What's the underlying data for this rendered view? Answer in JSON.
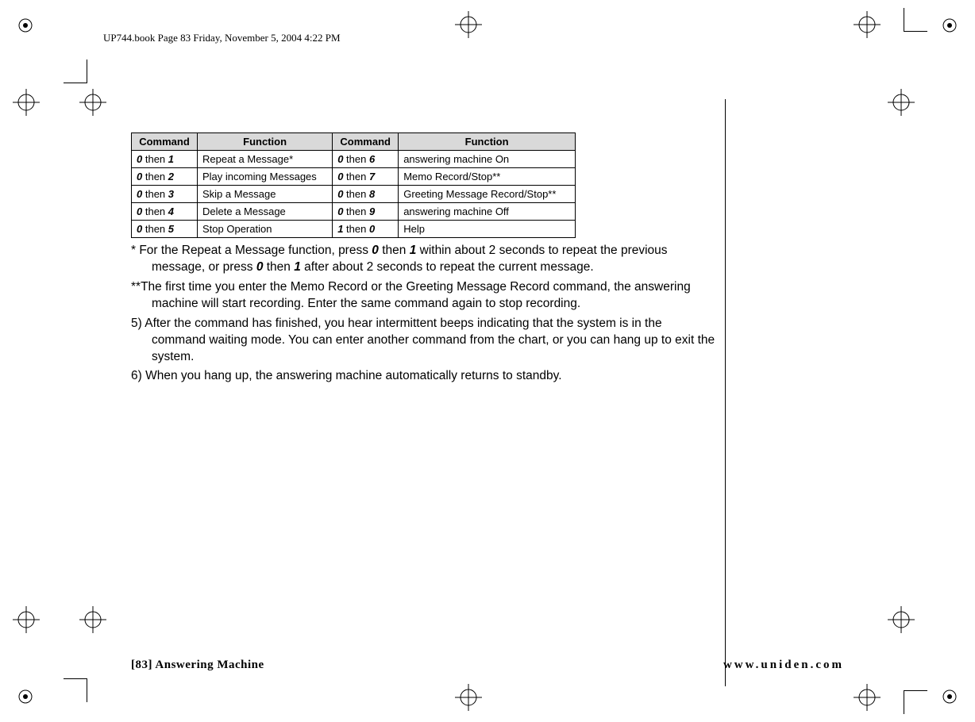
{
  "header": "UP744.book  Page 83  Friday, November 5, 2004  4:22 PM",
  "table": {
    "headers": [
      "Command",
      "Function",
      "Command",
      "Function"
    ],
    "rows": [
      {
        "c1a": "0",
        "c1m": " then ",
        "c1b": "1",
        "f1": "Repeat a Message*",
        "c2a": "0",
        "c2m": " then ",
        "c2b": "6",
        "f2": "answering machine On"
      },
      {
        "c1a": "0",
        "c1m": " then ",
        "c1b": "2",
        "f1": "Play incoming Messages",
        "c2a": "0",
        "c2m": " then ",
        "c2b": "7",
        "f2": "Memo Record/Stop**"
      },
      {
        "c1a": "0",
        "c1m": " then ",
        "c1b": "3",
        "f1": "Skip a Message",
        "c2a": "0",
        "c2m": " then ",
        "c2b": "8",
        "f2": "Greeting Message Record/Stop**"
      },
      {
        "c1a": "0",
        "c1m": " then ",
        "c1b": "4",
        "f1": "Delete a Message",
        "c2a": "0",
        "c2m": " then ",
        "c2b": "9",
        "f2": "answering machine Off"
      },
      {
        "c1a": "0",
        "c1m": " then ",
        "c1b": "5",
        "f1": "Stop Operation",
        "c2a": "1",
        "c2m": " then ",
        "c2b": "0",
        "f2": "Help"
      }
    ]
  },
  "notes": {
    "n1_a": "*  For the Repeat a Message function, press ",
    "n1_k1": "0",
    "n1_b": " then ",
    "n1_k2": "1",
    "n1_c": " within about 2 seconds to repeat the previous message, or press ",
    "n1_k3": "0",
    "n1_d": " then ",
    "n1_k4": "1",
    "n1_e": " after about 2 seconds to repeat the current message.",
    "n2": "**The first time you enter the Memo Record or the Greeting Message Record command, the answering machine will start recording. Enter the same command again to stop recording.",
    "n3": "5) After the command has finished, you hear intermittent beeps indicating that the system is in the command waiting mode. You can enter another command from the chart, or you can hang up to exit the system.",
    "n4": "6) When you hang up, the answering machine automatically returns to standby."
  },
  "footer": {
    "left": "[83] Answering Machine",
    "right": "www.uniden.com"
  }
}
